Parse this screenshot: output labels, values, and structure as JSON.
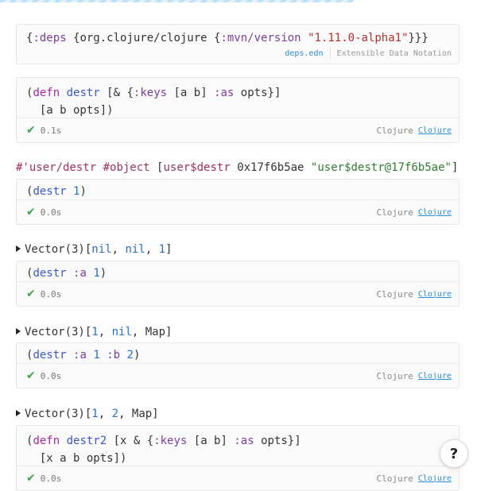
{
  "deps_cell": {
    "code": [
      "{",
      ":deps",
      " {org.clojure/clojure {",
      ":mvn/version",
      " ",
      "\"1.11.0-alpha1\"",
      "}}}"
    ],
    "filename": "deps.edn",
    "file_desc": "Extensible Data Notation"
  },
  "cells": [
    {
      "line1": [
        "(",
        "defn",
        " ",
        "destr",
        " [& {",
        ":keys",
        " [a b] ",
        ":as",
        " opts}]"
      ],
      "line2": "  [a b opts])",
      "time": "0.1s",
      "lang": "Clojure",
      "lang_link": "Clojure"
    },
    {
      "line1": [
        "(",
        "destr",
        " ",
        "1",
        ")"
      ],
      "time": "0.0s",
      "lang": "Clojure",
      "lang_link": "Clojure"
    },
    {
      "line1": [
        "(",
        "destr",
        " ",
        ":a",
        " ",
        "1",
        ")"
      ],
      "time": "0.0s",
      "lang": "Clojure",
      "lang_link": "Clojure"
    },
    {
      "line1": [
        "(",
        "destr",
        " ",
        ":a",
        " ",
        "1",
        " ",
        ":b",
        " ",
        "2",
        ")"
      ],
      "time": "0.0s",
      "lang": "Clojure",
      "lang_link": "Clojure"
    },
    {
      "line1": [
        "(",
        "defn",
        " ",
        "destr2",
        " [x & {",
        ":keys",
        " [a b] ",
        ":as",
        " opts}]"
      ],
      "line2": "  [x a b opts])",
      "time": "0.0s",
      "lang": "Clojure",
      "lang_link": "Clojure"
    }
  ],
  "results": {
    "r1": [
      "#'user/destr",
      " ",
      "#object",
      " [",
      "user$destr",
      " 0x17f6b5ae ",
      "\"user$destr@17f6b5ae\"",
      "]"
    ],
    "r2": [
      "Vector(3)[",
      "nil",
      ", ",
      "nil",
      ", ",
      "1",
      "]"
    ],
    "r3": [
      "Vector(3)[",
      "1",
      ", ",
      "nil",
      ", Map]"
    ],
    "r4": [
      "Vector(3)[",
      "1",
      ", ",
      "2",
      ", Map]"
    ]
  },
  "help_label": "?",
  "icons": {
    "tick": "check-icon",
    "triangle": "triangle-right-icon",
    "help": "question-icon"
  },
  "colors": {
    "keyword": "#7a3e9d",
    "defn": "#a626a4",
    "symbol": "#3a58c9",
    "string": "#2e7d32",
    "number": "#2b6fc0",
    "success": "#3aa54a",
    "link": "#2b8fd6"
  }
}
